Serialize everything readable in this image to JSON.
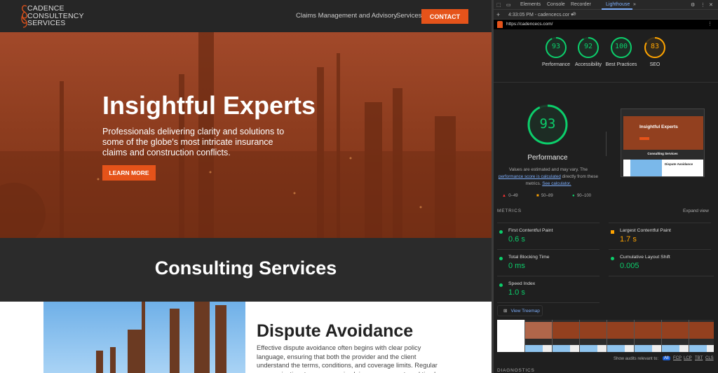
{
  "site": {
    "logo": [
      "CADENCE",
      "CONSULTENCY",
      "SERVICES"
    ],
    "nav": [
      "Claims Management and Advisory",
      "Services"
    ],
    "contact": "CONTACT",
    "hero": {
      "title": "Insightful Experts",
      "subtitle": "Professionals delivering clarity and solutions to some of the globe's most intricate insurance claims and construction conflicts.",
      "button": "LEARN MORE"
    },
    "section_title": "Consulting Services",
    "article": {
      "title": "Dispute Avoidance",
      "body": "Effective dispute avoidance often begins with clear policy language, ensuring that both the provider and the client understand the terms, conditions, and coverage limits. Regular communication, transparency in claims assessment, and timely"
    },
    "brand_color": "#e5531a"
  },
  "devtools": {
    "tabs": [
      "Elements",
      "Console",
      "Recorder",
      "Lighthouse"
    ],
    "active_tab": "Lighthouse",
    "report_selector": "4:33:05 PM - cadencecs.cor",
    "url": "https://cadencecs.com/",
    "gauges": [
      {
        "label": "Performance",
        "score": 93,
        "color": "#0cce6b"
      },
      {
        "label": "Accessibility",
        "score": 92,
        "color": "#0cce6b"
      },
      {
        "label": "Best Practices",
        "score": 100,
        "color": "#0cce6b"
      },
      {
        "label": "SEO",
        "score": 83,
        "color": "#ffa400"
      }
    ],
    "main_gauge": {
      "score": 93,
      "label": "Performance"
    },
    "note": {
      "t1": "Values are estimated and may vary. The ",
      "l1": "performance score is calculated",
      "t2": " directly from these metrics. ",
      "l2": "See calculator."
    },
    "legend": [
      "0–49",
      "50–89",
      "90–100"
    ],
    "thumb": {
      "title": "Insightful Experts",
      "section": "Consulting Services",
      "article": "Dispute Avoidance"
    },
    "metrics_label": "METRICS",
    "expand": "Expand view",
    "metrics": [
      {
        "name": "First Contentful Paint",
        "value": "0.6 s",
        "status": "good"
      },
      {
        "name": "Largest Contentful Paint",
        "value": "1.7 s",
        "status": "average"
      },
      {
        "name": "Total Blocking Time",
        "value": "0 ms",
        "status": "good"
      },
      {
        "name": "Cumulative Layout Shift",
        "value": "0.005",
        "status": "good"
      },
      {
        "name": "Speed Index",
        "value": "1.0 s",
        "status": "good"
      }
    ],
    "treemap": "View Treemap",
    "filter_label": "Show audits relevant to:",
    "filters": [
      "All",
      "FCP",
      "LCP",
      "TBT",
      "CLS"
    ],
    "diagnostics": "DIAGNOSTICS"
  }
}
